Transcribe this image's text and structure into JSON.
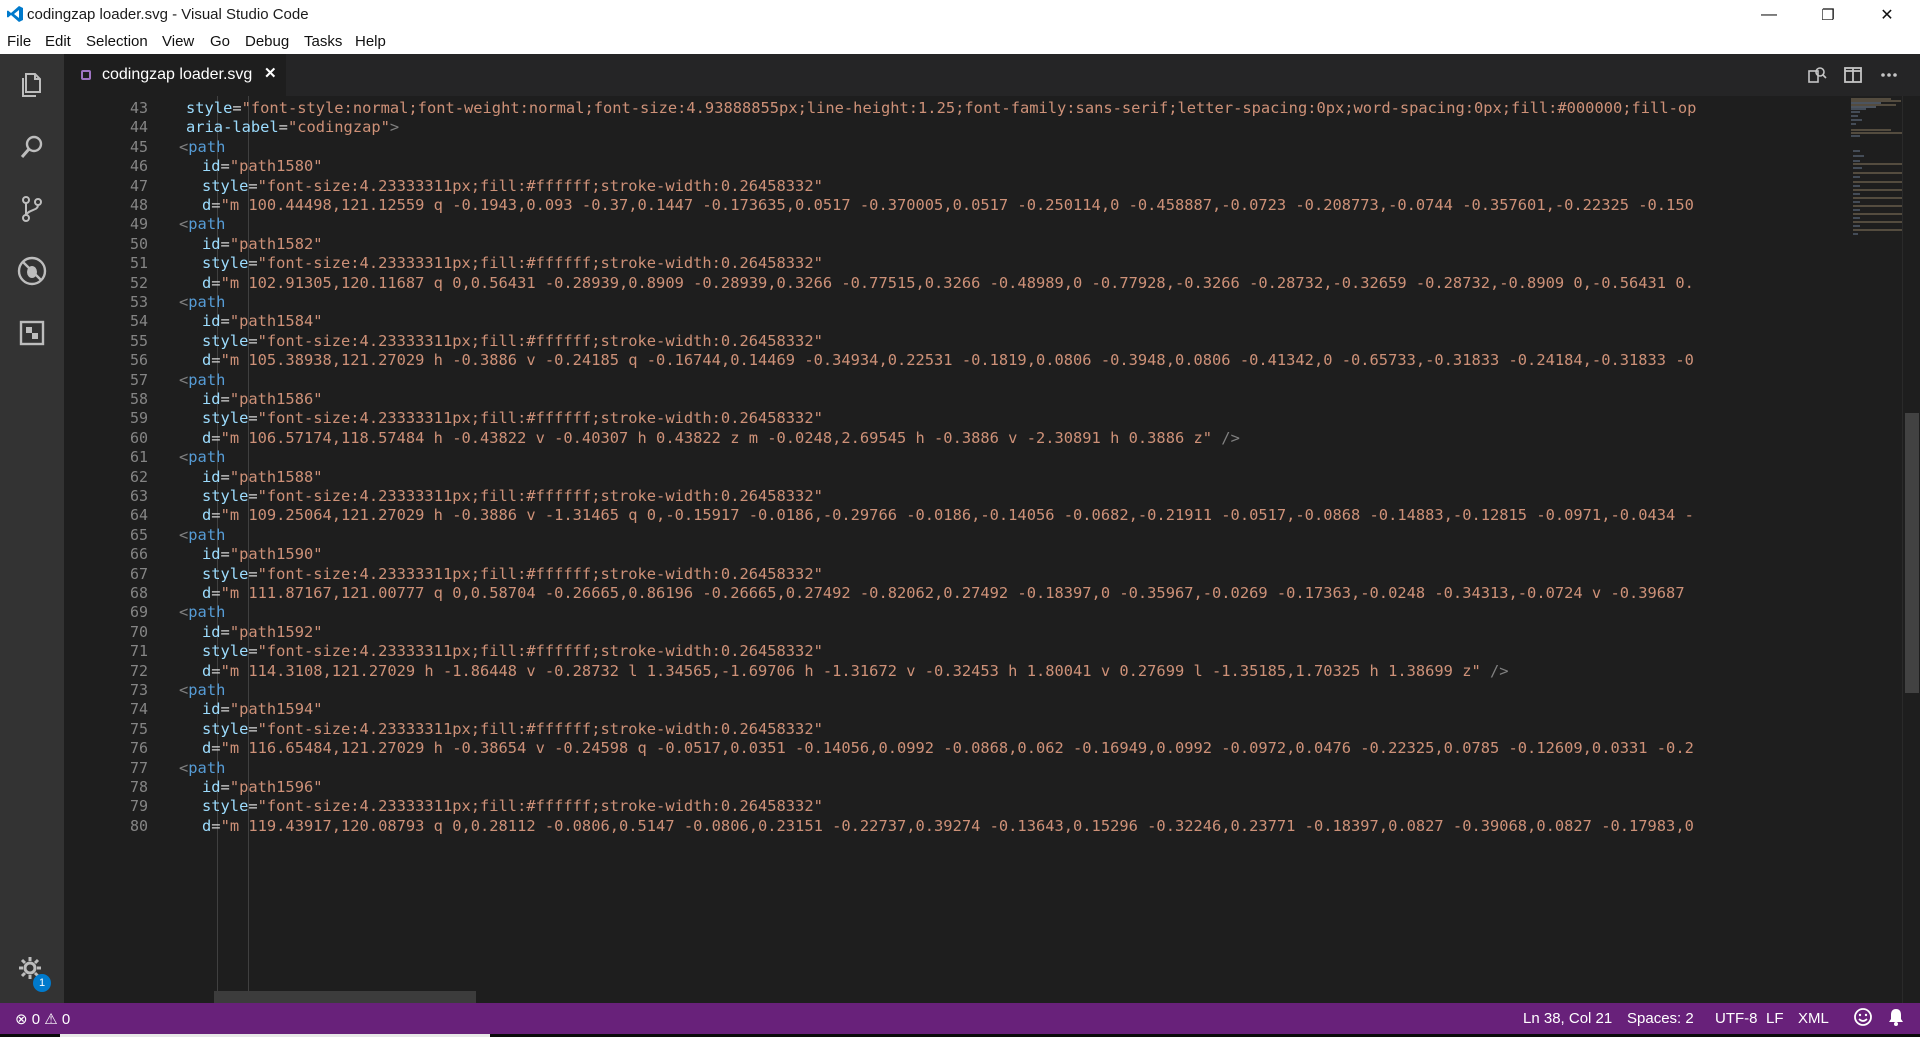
{
  "window": {
    "title": "codingzap loader.svg - Visual Studio Code",
    "minimize_glyph": "—",
    "restore_glyph": "❐",
    "close_glyph": "✕"
  },
  "menu": [
    "File",
    "Edit",
    "Selection",
    "View",
    "Go",
    "Debug",
    "Tasks",
    "Help"
  ],
  "activity": [
    "explorer-icon",
    "search-icon",
    "source-control-icon",
    "debug-icon",
    "extensions-icon",
    "settings-gear-icon"
  ],
  "activity_badge": "1",
  "tab": {
    "name": "codingzap loader.svg",
    "close_glyph": "✕"
  },
  "editor": {
    "lines": [
      {
        "n": "43",
        "kind": "attr",
        "indent": 2,
        "name": "style",
        "value": "\"font-style:normal;font-weight:normal;font-size:4.93888855px;line-height:1.25;font-family:sans-serif;letter-spacing:0px;word-spacing:0px;fill:#000000;fill-op"
      },
      {
        "n": "44",
        "kind": "attr",
        "indent": 2,
        "name": "aria-label",
        "value": "\"codingzap\"",
        "tail": ">"
      },
      {
        "n": "45",
        "kind": "tag",
        "indent": 1,
        "tag": "<path"
      },
      {
        "n": "46",
        "kind": "attr",
        "indent": 3,
        "name": "id",
        "value": "\"path1580\""
      },
      {
        "n": "47",
        "kind": "attr",
        "indent": 3,
        "name": "style",
        "value": "\"font-size:4.23333311px;fill:#ffffff;stroke-width:0.26458332\""
      },
      {
        "n": "48",
        "kind": "attr",
        "indent": 3,
        "name": "d",
        "value": "\"m 100.44498,121.12559 q -0.1943,0.093 -0.37,0.1447 -0.173635,0.0517 -0.370005,0.0517 -0.250114,0 -0.458887,-0.0723 -0.208773,-0.0744 -0.357601,-0.22325 -0.150"
      },
      {
        "n": "49",
        "kind": "tag",
        "indent": 1,
        "tag": "<path"
      },
      {
        "n": "50",
        "kind": "attr",
        "indent": 3,
        "name": "id",
        "value": "\"path1582\""
      },
      {
        "n": "51",
        "kind": "attr",
        "indent": 3,
        "name": "style",
        "value": "\"font-size:4.23333311px;fill:#ffffff;stroke-width:0.26458332\""
      },
      {
        "n": "52",
        "kind": "attr",
        "indent": 3,
        "name": "d",
        "value": "\"m 102.91305,120.11687 q 0,0.56431 -0.28939,0.8909 -0.28939,0.3266 -0.77515,0.3266 -0.48989,0 -0.77928,-0.3266 -0.28732,-0.32659 -0.28732,-0.8909 0,-0.56431 0."
      },
      {
        "n": "53",
        "kind": "tag",
        "indent": 1,
        "tag": "<path"
      },
      {
        "n": "54",
        "kind": "attr",
        "indent": 3,
        "name": "id",
        "value": "\"path1584\""
      },
      {
        "n": "55",
        "kind": "attr",
        "indent": 3,
        "name": "style",
        "value": "\"font-size:4.23333311px;fill:#ffffff;stroke-width:0.26458332\""
      },
      {
        "n": "56",
        "kind": "attr",
        "indent": 3,
        "name": "d",
        "value": "\"m 105.38938,121.27029 h -0.3886 v -0.24185 q -0.16744,0.14469 -0.34934,0.22531 -0.1819,0.0806 -0.3948,0.0806 -0.41342,0 -0.65733,-0.31833 -0.24184,-0.31833 -0"
      },
      {
        "n": "57",
        "kind": "tag",
        "indent": 1,
        "tag": "<path"
      },
      {
        "n": "58",
        "kind": "attr",
        "indent": 3,
        "name": "id",
        "value": "\"path1586\""
      },
      {
        "n": "59",
        "kind": "attr",
        "indent": 3,
        "name": "style",
        "value": "\"font-size:4.23333311px;fill:#ffffff;stroke-width:0.26458332\""
      },
      {
        "n": "60",
        "kind": "attr",
        "indent": 3,
        "name": "d",
        "value": "\"m 106.57174,118.57484 h -0.43822 v -0.40307 h 0.43822 z m -0.0248,2.69545 h -0.3886 v -2.30891 h 0.3886 z\"",
        "tail": " />"
      },
      {
        "n": "61",
        "kind": "tag",
        "indent": 1,
        "tag": "<path"
      },
      {
        "n": "62",
        "kind": "attr",
        "indent": 3,
        "name": "id",
        "value": "\"path1588\""
      },
      {
        "n": "63",
        "kind": "attr",
        "indent": 3,
        "name": "style",
        "value": "\"font-size:4.23333311px;fill:#ffffff;stroke-width:0.26458332\""
      },
      {
        "n": "64",
        "kind": "attr",
        "indent": 3,
        "name": "d",
        "value": "\"m 109.25064,121.27029 h -0.3886 v -1.31465 q 0,-0.15917 -0.0186,-0.29766 -0.0186,-0.14056 -0.0682,-0.21911 -0.0517,-0.0868 -0.14883,-0.12815 -0.0971,-0.0434 -"
      },
      {
        "n": "65",
        "kind": "tag",
        "indent": 1,
        "tag": "<path"
      },
      {
        "n": "66",
        "kind": "attr",
        "indent": 3,
        "name": "id",
        "value": "\"path1590\""
      },
      {
        "n": "67",
        "kind": "attr",
        "indent": 3,
        "name": "style",
        "value": "\"font-size:4.23333311px;fill:#ffffff;stroke-width:0.26458332\""
      },
      {
        "n": "68",
        "kind": "attr",
        "indent": 3,
        "name": "d",
        "value": "\"m 111.87167,121.00777 q 0,0.58704 -0.26665,0.86196 -0.26665,0.27492 -0.82062,0.27492 -0.18397,0 -0.35967,-0.0269 -0.17363,-0.0248 -0.34313,-0.0724 v -0.39687"
      },
      {
        "n": "69",
        "kind": "tag",
        "indent": 1,
        "tag": "<path"
      },
      {
        "n": "70",
        "kind": "attr",
        "indent": 3,
        "name": "id",
        "value": "\"path1592\""
      },
      {
        "n": "71",
        "kind": "attr",
        "indent": 3,
        "name": "style",
        "value": "\"font-size:4.23333311px;fill:#ffffff;stroke-width:0.26458332\""
      },
      {
        "n": "72",
        "kind": "attr",
        "indent": 3,
        "name": "d",
        "value": "\"m 114.3108,121.27029 h -1.86448 v -0.28732 l 1.34565,-1.69706 h -1.31672 v -0.32453 h 1.80041 v 0.27699 l -1.35185,1.70325 h 1.38699 z\"",
        "tail": " />"
      },
      {
        "n": "73",
        "kind": "tag",
        "indent": 1,
        "tag": "<path"
      },
      {
        "n": "74",
        "kind": "attr",
        "indent": 3,
        "name": "id",
        "value": "\"path1594\""
      },
      {
        "n": "75",
        "kind": "attr",
        "indent": 3,
        "name": "style",
        "value": "\"font-size:4.23333311px;fill:#ffffff;stroke-width:0.26458332\""
      },
      {
        "n": "76",
        "kind": "attr",
        "indent": 3,
        "name": "d",
        "value": "\"m 116.65484,121.27029 h -0.38654 v -0.24598 q -0.0517,0.0351 -0.14056,0.0992 -0.0868,0.062 -0.16949,0.0992 -0.0972,0.0476 -0.22325,0.0785 -0.12609,0.0331 -0.2"
      },
      {
        "n": "77",
        "kind": "tag",
        "indent": 1,
        "tag": "<path"
      },
      {
        "n": "78",
        "kind": "attr",
        "indent": 3,
        "name": "id",
        "value": "\"path1596\""
      },
      {
        "n": "79",
        "kind": "attr",
        "indent": 3,
        "name": "style",
        "value": "\"font-size:4.23333311px;fill:#ffffff;stroke-width:0.26458332\""
      },
      {
        "n": "80",
        "kind": "attr",
        "indent": 3,
        "name": "d",
        "value": "\"m 119.43917,120.08793 q 0,0.28112 -0.0806,0.5147 -0.0806,0.23151 -0.22737,0.39274 -0.13643,0.15296 -0.32246,0.23771 -0.18397,0.0827 -0.39068,0.0827 -0.17983,0"
      }
    ]
  },
  "status": {
    "errors": "0",
    "warnings": "0",
    "position": "Ln 38, Col 21",
    "spaces": "Spaces: 2",
    "encoding": "UTF-8",
    "eol": "LF",
    "language": "XML"
  },
  "colors": {
    "status_bar": "#68217a",
    "activity_bar": "#333333",
    "editor_bg": "#1e1e1e",
    "attr": "#9cdcfe",
    "string": "#ce9178",
    "tag": "#569cd6"
  }
}
